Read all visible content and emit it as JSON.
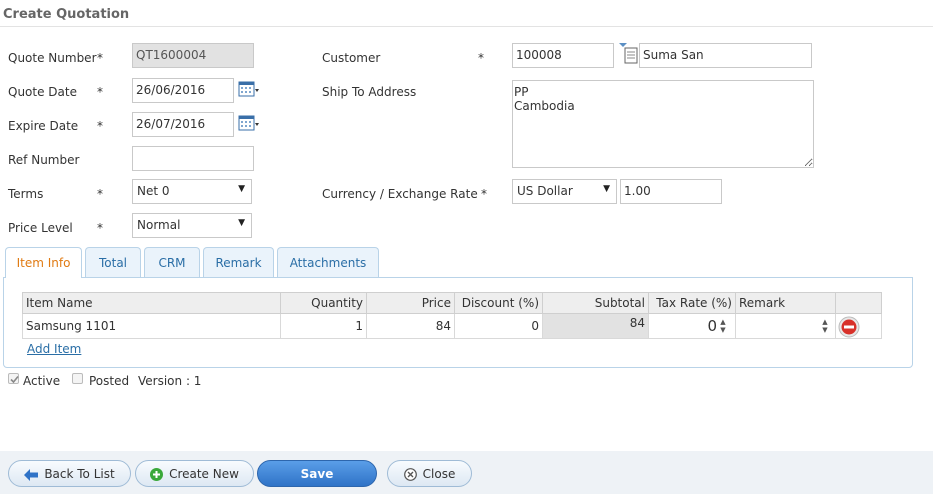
{
  "header": {
    "title": "Create Quotation"
  },
  "form": {
    "quote_number": {
      "label": "Quote Number",
      "required": "*",
      "value": "QT1600004"
    },
    "quote_date": {
      "label": "Quote Date",
      "required": "*",
      "value": "26/06/2016"
    },
    "expire_date": {
      "label": "Expire Date",
      "required": "*",
      "value": "26/07/2016"
    },
    "ref_number": {
      "label": "Ref Number",
      "value": ""
    },
    "terms": {
      "label": "Terms",
      "required": "*",
      "value": "Net 0"
    },
    "price_level": {
      "label": "Price Level",
      "required": "*",
      "value": "Normal"
    },
    "customer": {
      "label": "Customer",
      "required": "*",
      "code": "100008",
      "name": "Suma San"
    },
    "ship_to": {
      "label": "Ship To Address",
      "value": "PP\nCambodia"
    },
    "currency": {
      "label": "Currency / Exchange Rate",
      "required": "*",
      "value": "US Dollar",
      "rate": "1.00"
    }
  },
  "tabs": [
    {
      "label": "Item Info",
      "active": true
    },
    {
      "label": "Total"
    },
    {
      "label": "CRM"
    },
    {
      "label": "Remark"
    },
    {
      "label": "Attachments"
    }
  ],
  "grid": {
    "columns": [
      "Item Name",
      "Quantity",
      "Price",
      "Discount (%)",
      "Subtotal",
      "Tax Rate (%)",
      "Remark"
    ],
    "rows": [
      {
        "item_name": "Samsung 1101",
        "quantity": "1",
        "price": "84",
        "discount": "0",
        "subtotal": "84",
        "tax_rate": "0",
        "remark": ""
      }
    ],
    "add_item": "Add Item"
  },
  "status": {
    "active_label": "Active",
    "posted_label": "Posted",
    "version": "Version : 1"
  },
  "footer": {
    "back": "Back To List",
    "create_new": "Create New",
    "save": "Save",
    "close": "Close"
  },
  "icons": {
    "calendar": "calendar-icon",
    "lookup": "lookup-icon",
    "remove": "remove-row-icon",
    "back": "arrow-left-icon",
    "add": "plus-circle-icon",
    "close": "close-circle-icon"
  },
  "colors": {
    "accent": "#2f73c7",
    "active_tab": "#e07a12",
    "link": "#2a6ea6"
  }
}
